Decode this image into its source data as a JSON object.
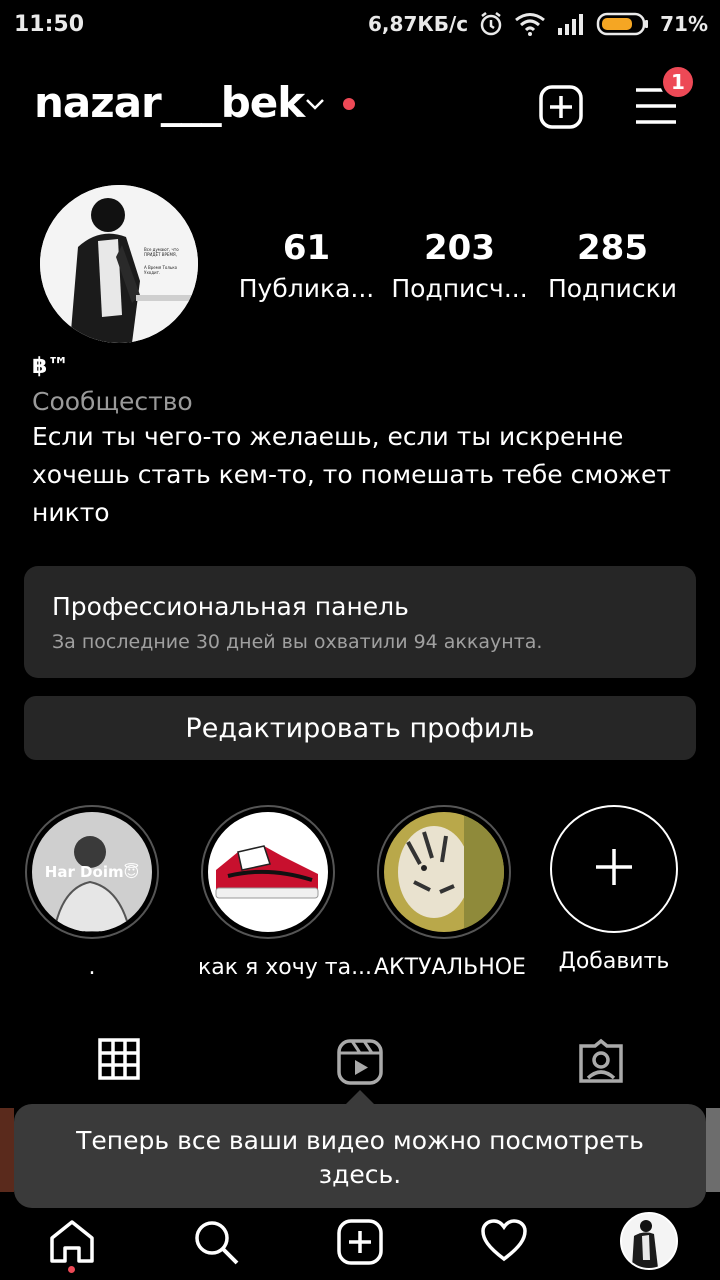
{
  "colors": {
    "accent_red": "#ed4956",
    "background": "#000000",
    "card": "#262626",
    "tooltip": "#3a3a3a"
  },
  "status_bar": {
    "time": "11:50",
    "speed": "6,87КБ/с",
    "battery": "71%",
    "icons": [
      "alarm-icon",
      "wifi-icon",
      "signal-icon",
      "battery-icon"
    ]
  },
  "header": {
    "username": "nazar___bek",
    "notification_count": "1"
  },
  "profile": {
    "stats": [
      {
        "value": "61",
        "label": "Публика..."
      },
      {
        "value": "203",
        "label": "Подписч..."
      },
      {
        "value": "285",
        "label": "Подписки"
      }
    ],
    "name": "฿™",
    "category": "Сообщество",
    "bio": "Если ты чего-то желаешь, если ты искренне хочешь стать кем-то, то помешать тебе сможет никто"
  },
  "pro_panel": {
    "title": "Профессиональная панель",
    "subtitle": "За последние 30 дней вы охватили 94 аккаунта."
  },
  "edit_profile_label": "Редактировать профиль",
  "highlights": [
    {
      "label": ".",
      "cover_text": "Har Doim😇"
    },
    {
      "label": "как я хочу та..."
    },
    {
      "label": "АКТУАЛЬНОЕ"
    },
    {
      "label": "Добавить"
    }
  ],
  "tabs": [
    "grid-icon",
    "reels-icon",
    "tagged-icon"
  ],
  "tooltip": {
    "text": "Теперь все ваши видео можно посмотреть здесь."
  },
  "bottom_nav": [
    "home-icon",
    "search-icon",
    "create-icon",
    "activity-icon",
    "profile-avatar"
  ]
}
